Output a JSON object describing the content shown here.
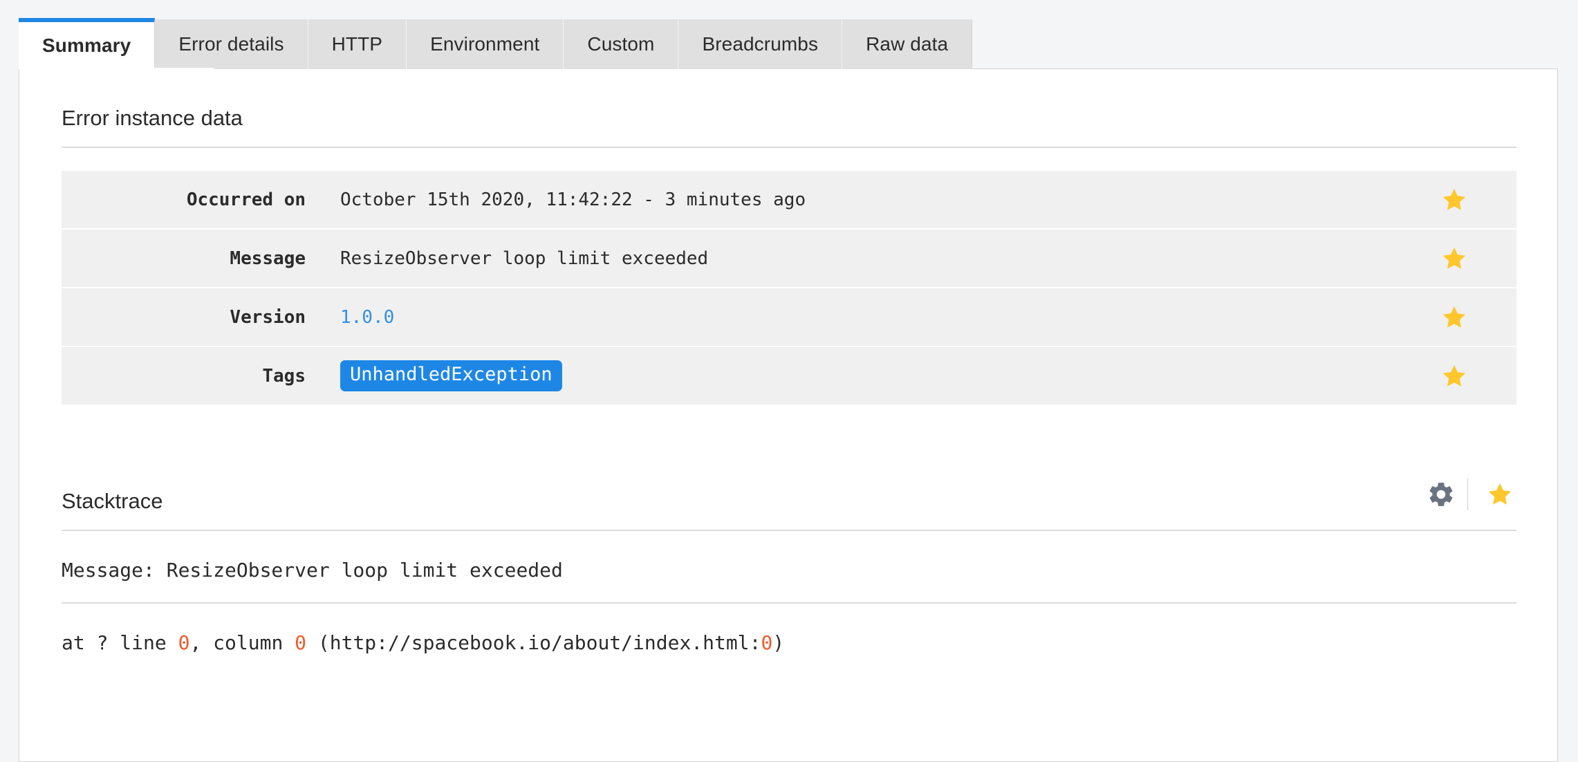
{
  "tabs": [
    {
      "label": "Summary",
      "active": true,
      "name": "tab-summary"
    },
    {
      "label": "Error details",
      "active": false,
      "name": "tab-error-details"
    },
    {
      "label": "HTTP",
      "active": false,
      "name": "tab-http"
    },
    {
      "label": "Environment",
      "active": false,
      "name": "tab-environment"
    },
    {
      "label": "Custom",
      "active": false,
      "name": "tab-custom"
    },
    {
      "label": "Breadcrumbs",
      "active": false,
      "name": "tab-breadcrumbs"
    },
    {
      "label": "Raw data",
      "active": false,
      "name": "tab-raw-data"
    }
  ],
  "error_instance": {
    "title": "Error instance data",
    "rows": [
      {
        "label": "Occurred on",
        "value": "October 15th 2020, 11:42:22 - 3 minutes ago",
        "type": "text",
        "starred": true
      },
      {
        "label": "Message",
        "value": "ResizeObserver loop limit exceeded",
        "type": "text",
        "starred": true
      },
      {
        "label": "Version",
        "value": "1.0.0",
        "type": "link",
        "starred": true
      },
      {
        "label": "Tags",
        "value": "UnhandledException",
        "type": "badge",
        "starred": true
      }
    ]
  },
  "stacktrace": {
    "title": "Stacktrace",
    "settings_icon": "gear-icon",
    "star_icon": "star-icon",
    "lines": [
      {
        "prefix": "Message: ResizeObserver loop limit exceeded",
        "parts": []
      },
      {
        "prefix": "",
        "parts": [
          {
            "text": "at ? line ",
            "highlight": false
          },
          {
            "text": "0",
            "highlight": true
          },
          {
            "text": ", column ",
            "highlight": false
          },
          {
            "text": "0",
            "highlight": true
          },
          {
            "text": " (http://spacebook.io/about/index.html:",
            "highlight": false
          },
          {
            "text": "0",
            "highlight": true
          },
          {
            "text": ")",
            "highlight": false
          }
        ]
      }
    ]
  },
  "colors": {
    "accent_blue": "#1e87e5",
    "link_blue": "#2f8fe8",
    "star_yellow": "#ffc72c",
    "gear_gray": "#6b7280",
    "number_orange": "#f05a28",
    "page_bg": "#f4f5f7",
    "row_bg": "#f0f0f0",
    "tab_inactive_bg": "#e0e0e0"
  }
}
